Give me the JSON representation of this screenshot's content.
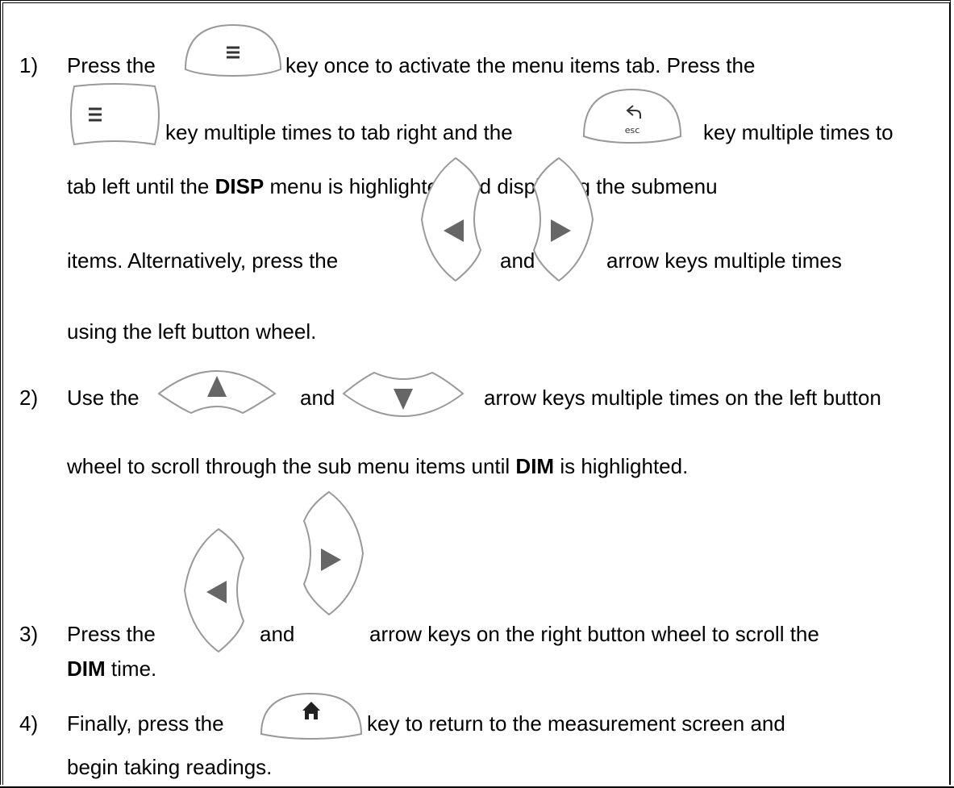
{
  "steps": [
    {
      "number": "1)",
      "line1": {
        "pre": "Press the",
        "post": "key once to activate the menu items tab.  Press the"
      },
      "line2": {
        "mid": "key multiple times to tab right and the",
        "post": "key multiple times to"
      },
      "line3": {
        "pre": "tab left until the",
        "bold": "DISP",
        "post": "menu is highlighted and displaying the submenu"
      },
      "line4": {
        "pre": "items.  Alternatively, press the",
        "mid": "and",
        "post": "arrow keys multiple times"
      },
      "line5": "using the left button wheel."
    },
    {
      "number": "2)",
      "line1": {
        "pre": "Use the",
        "mid": "and",
        "post": "arrow keys multiple times on the left button"
      },
      "line2": {
        "pre": "wheel to scroll through the sub menu items until",
        "bold": "DIM",
        "post": "is highlighted."
      }
    },
    {
      "number": "3)",
      "line1": {
        "pre": "Press the",
        "mid": "and",
        "post": "arrow keys on the right button wheel to scroll the"
      },
      "line2": {
        "bold": "DIM",
        "post": "time."
      }
    },
    {
      "number": "4)",
      "line1": {
        "pre": "Finally, press the",
        "post": "key to return to the measurement screen and"
      },
      "line2": "begin taking readings."
    }
  ],
  "keys": {
    "esc_label": "esc",
    "icons": [
      "menu-icon",
      "esc-icon",
      "left-arrow-icon",
      "right-arrow-icon",
      "up-arrow-icon",
      "down-arrow-icon",
      "home-icon"
    ]
  }
}
